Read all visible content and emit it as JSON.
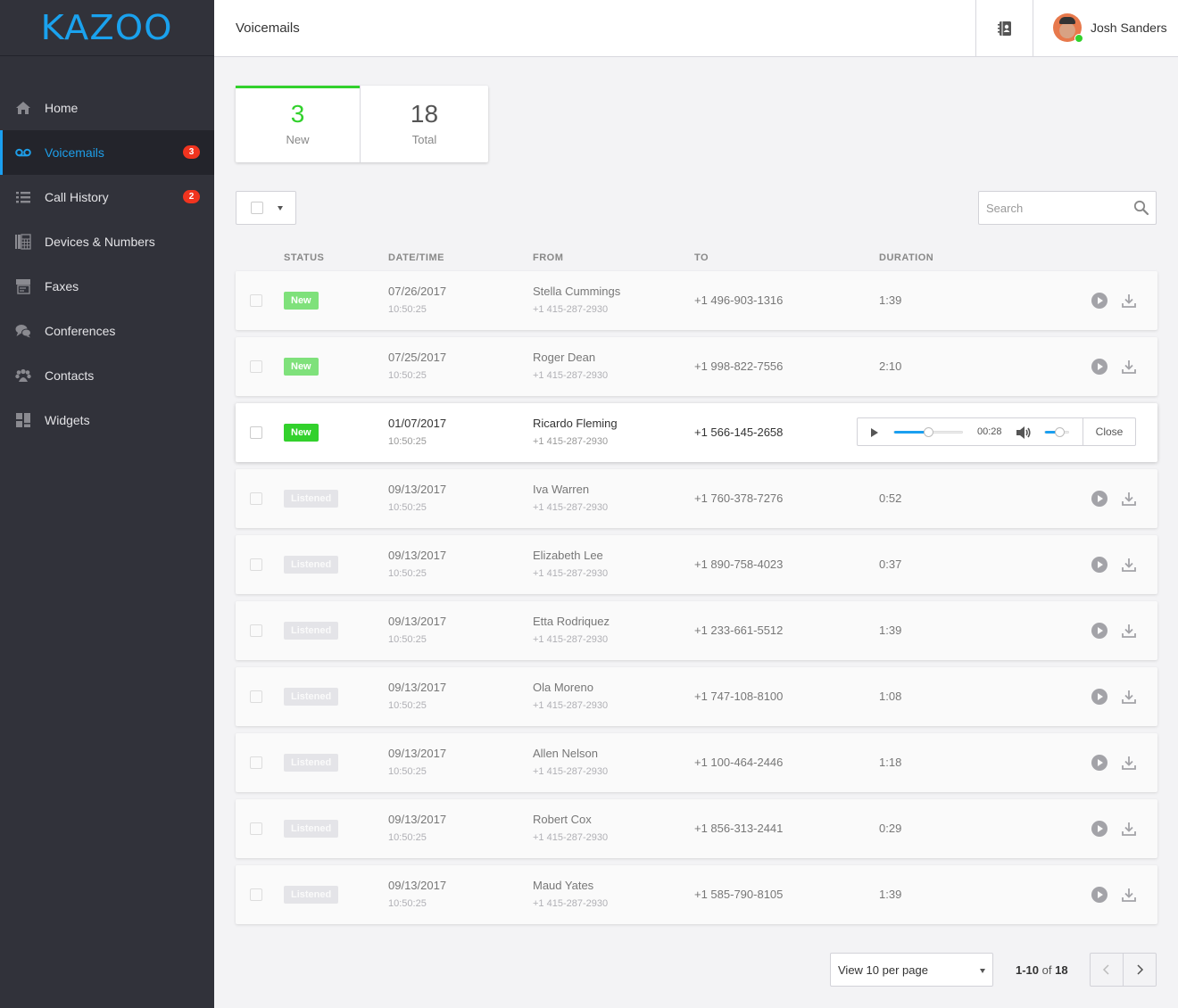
{
  "app": {
    "logo": "KAZOO",
    "accent": "#1a9ff0",
    "new_color": "#32d12c",
    "badge_color": "#f0341f"
  },
  "sidebar": {
    "items": [
      {
        "label": "Home",
        "icon": "home-icon",
        "active": false,
        "badge": null
      },
      {
        "label": "Voicemails",
        "icon": "voicemail-icon",
        "active": true,
        "badge": "3"
      },
      {
        "label": "Call History",
        "icon": "list-icon",
        "active": false,
        "badge": "2"
      },
      {
        "label": "Devices & Numbers",
        "icon": "devices-icon",
        "active": false,
        "badge": null
      },
      {
        "label": "Faxes",
        "icon": "fax-icon",
        "active": false,
        "badge": null
      },
      {
        "label": "Conferences",
        "icon": "conference-icon",
        "active": false,
        "badge": null
      },
      {
        "label": "Contacts",
        "icon": "contacts-icon",
        "active": false,
        "badge": null
      },
      {
        "label": "Widgets",
        "icon": "widgets-icon",
        "active": false,
        "badge": null
      }
    ]
  },
  "header": {
    "title": "Voicemails",
    "user_name": "Josh Sanders",
    "user_status": "online"
  },
  "stats": {
    "new_value": "3",
    "new_label": "New",
    "total_value": "18",
    "total_label": "Total"
  },
  "toolbar": {
    "search_placeholder": "Search",
    "search_value": ""
  },
  "table": {
    "columns": [
      "STATUS",
      "DATE/TIME",
      "FROM",
      "TO",
      "DURATION"
    ],
    "rows": [
      {
        "status": "New",
        "date": "07/26/2017",
        "time": "10:50:25",
        "from": "Stella Cummings",
        "from_number": "+1 415-287-2930",
        "to": "+1 496-903-1316",
        "duration": "1:39"
      },
      {
        "status": "New",
        "date": "07/25/2017",
        "time": "10:50:25",
        "from": "Roger Dean",
        "from_number": "+1 415-287-2930",
        "to": "+1 998-822-7556",
        "duration": "2:10"
      },
      {
        "status": "New",
        "date": "01/07/2017",
        "time": "10:50:25",
        "from": "Ricardo Fleming",
        "from_number": "+1 415-287-2930",
        "to": "+1 566-145-2658",
        "duration": "",
        "playing": true
      },
      {
        "status": "Listened",
        "date": "09/13/2017",
        "time": "10:50:25",
        "from": "Iva Warren",
        "from_number": "+1 415-287-2930",
        "to": "+1 760-378-7276",
        "duration": "0:52"
      },
      {
        "status": "Listened",
        "date": "09/13/2017",
        "time": "10:50:25",
        "from": "Elizabeth Lee",
        "from_number": "+1 415-287-2930",
        "to": "+1 890-758-4023",
        "duration": "0:37"
      },
      {
        "status": "Listened",
        "date": "09/13/2017",
        "time": "10:50:25",
        "from": "Etta Rodriquez",
        "from_number": "+1 415-287-2930",
        "to": "+1 233-661-5512",
        "duration": "1:39"
      },
      {
        "status": "Listened",
        "date": "09/13/2017",
        "time": "10:50:25",
        "from": "Ola Moreno",
        "from_number": "+1 415-287-2930",
        "to": "+1 747-108-8100",
        "duration": "1:08"
      },
      {
        "status": "Listened",
        "date": "09/13/2017",
        "time": "10:50:25",
        "from": "Allen Nelson",
        "from_number": "+1 415-287-2930",
        "to": "+1 100-464-2446",
        "duration": "1:18"
      },
      {
        "status": "Listened",
        "date": "09/13/2017",
        "time": "10:50:25",
        "from": "Robert Cox",
        "from_number": "+1 415-287-2930",
        "to": "+1 856-313-2441",
        "duration": "0:29"
      },
      {
        "status": "Listened",
        "date": "09/13/2017",
        "time": "10:50:25",
        "from": "Maud Yates",
        "from_number": "+1 415-287-2930",
        "to": "+1 585-790-8105",
        "duration": "1:39"
      }
    ]
  },
  "player": {
    "elapsed": "00:28",
    "progress_fraction": 0.5,
    "volume_fraction": 0.6,
    "close_label": "Close"
  },
  "pagination": {
    "per_page_label": "View 10 per page",
    "range": "1-10",
    "of_label": "of",
    "total": "18"
  }
}
